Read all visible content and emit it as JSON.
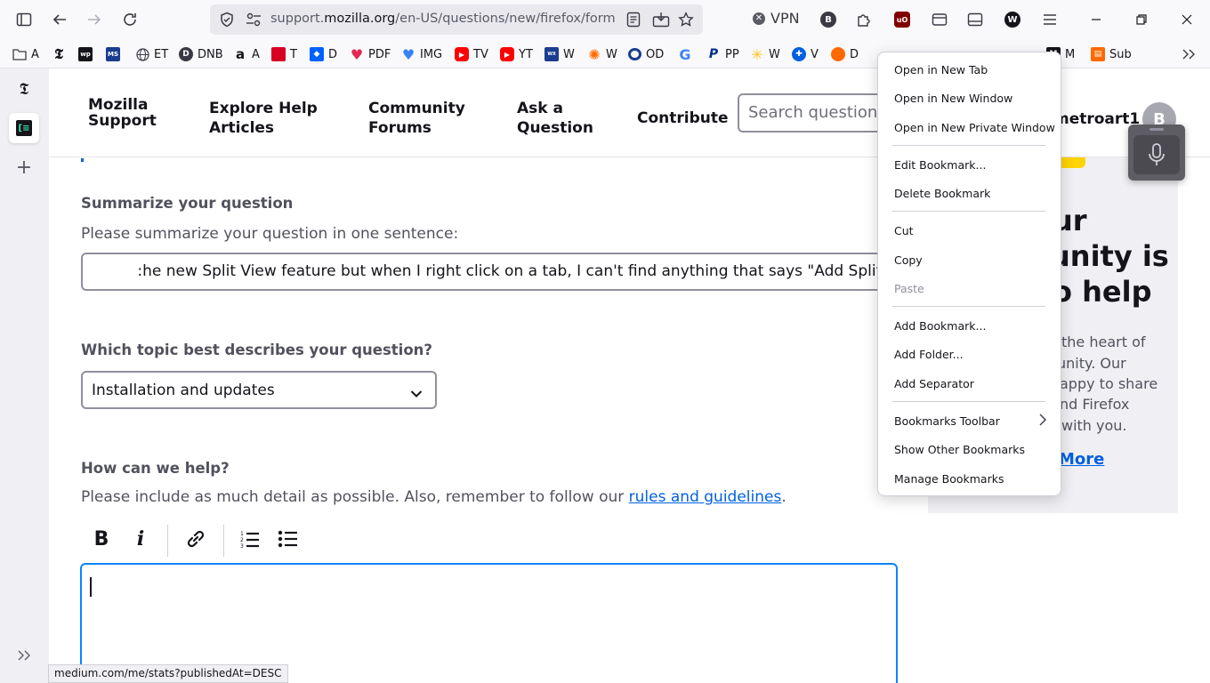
{
  "toolbar": {
    "url_prefix": "support.",
    "url_domain": "mozilla.org",
    "url_path": "/en-US/questions/new/firefox/form",
    "vpn_label": "VPN"
  },
  "bookmarks": [
    {
      "label": "A",
      "icon": "folder-icon",
      "color": "#5b5b66"
    },
    {
      "label": "",
      "icon": "nyt-icon",
      "color": "#15141a"
    },
    {
      "label": "",
      "icon": "wapo-icon",
      "color": "#15141a"
    },
    {
      "label": "",
      "icon": "ms-icon",
      "color": "#1b3d8f"
    },
    {
      "label": "ET",
      "icon": "globe-icon",
      "color": "#5b5b66"
    },
    {
      "label": "DNB",
      "icon": "dnb-icon",
      "color": "#3a3944"
    },
    {
      "label": "A",
      "icon": "amazon-icon",
      "color": "#ff9900"
    },
    {
      "label": "T",
      "icon": "t-icon",
      "color": "#d70022"
    },
    {
      "label": "D",
      "icon": "dropbox-icon",
      "color": "#0061fe"
    },
    {
      "label": "PDF",
      "icon": "heart-icon",
      "color": "#e22850"
    },
    {
      "label": "IMG",
      "icon": "img-icon",
      "color": "#3b82f6"
    },
    {
      "label": "TV",
      "icon": "youtube-icon",
      "color": "#ff0000"
    },
    {
      "label": "YT",
      "icon": "youtube-icon",
      "color": "#ff0000"
    },
    {
      "label": "W",
      "icon": "weather-icon",
      "color": "#1b3d8f"
    },
    {
      "label": "W",
      "icon": "sun-icon",
      "color": "#ff6a00"
    },
    {
      "label": "OD",
      "icon": "od-icon",
      "color": "#1b3d8f"
    },
    {
      "label": "",
      "icon": "google-icon",
      "color": "#4285f4"
    },
    {
      "label": "PP",
      "icon": "paypal-icon",
      "color": "#003087"
    },
    {
      "label": "W",
      "icon": "walmart-icon",
      "color": "#ffc220"
    },
    {
      "label": "V",
      "icon": "v-icon",
      "color": "#0060df"
    },
    {
      "label": "D",
      "icon": "d-icon",
      "color": "#ff6a00"
    },
    {
      "label": "M",
      "icon": "m-icon",
      "color": "#15141a"
    },
    {
      "label": "Sub",
      "icon": "sub-icon",
      "color": "#ff6a00"
    }
  ],
  "site": {
    "logo": "Mozilla Support",
    "nav": [
      "Explore Help Articles",
      "Community Forums",
      "Ask a Question",
      "Contribute"
    ],
    "search_placeholder": "Search questions",
    "username": "metroart1",
    "avatar_initial": "B"
  },
  "form": {
    "summary_heading": "Summarize your question",
    "summary_help": "Please summarize your question in one sentence:",
    "summary_value": ":he new Split View feature but when I right click on a tab, I can't find anything that says \"Add Split View",
    "topic_heading": "Which topic best describes your question?",
    "topic_value": "Installation and updates",
    "help_heading": "How can we help?",
    "help_text": "Please include as much detail as possible. Also, remember to follow our ",
    "help_link": "rules and guidelines",
    "help_end": "."
  },
  "promo": {
    "heading_lines": [
      "ur",
      "unity is",
      "o help"
    ],
    "body_lines": [
      "the heart of",
      "unity. Our",
      "appy to share",
      "nd Firefox",
      "with you."
    ],
    "link": "More"
  },
  "status_url": "medium.com/me/stats?publishedAt=DESC",
  "context_menu": {
    "items": [
      {
        "label": "Open in New Tab",
        "disabled": false
      },
      {
        "label": "Open in New Window",
        "disabled": false
      },
      {
        "label": "Open in New Private Window",
        "disabled": false
      },
      {
        "label": "Edit Bookmark...",
        "disabled": false
      },
      {
        "label": "Delete Bookmark",
        "disabled": false
      },
      {
        "label": "Cut",
        "disabled": false
      },
      {
        "label": "Copy",
        "disabled": false
      },
      {
        "label": "Paste",
        "disabled": true
      },
      {
        "label": "Add Bookmark...",
        "disabled": false
      },
      {
        "label": "Add Folder...",
        "disabled": false
      },
      {
        "label": "Add Separator",
        "disabled": false
      },
      {
        "label": "Bookmarks Toolbar",
        "disabled": false,
        "submenu": true
      },
      {
        "label": "Show Other Bookmarks",
        "disabled": false
      },
      {
        "label": "Manage Bookmarks",
        "disabled": false
      }
    ]
  }
}
